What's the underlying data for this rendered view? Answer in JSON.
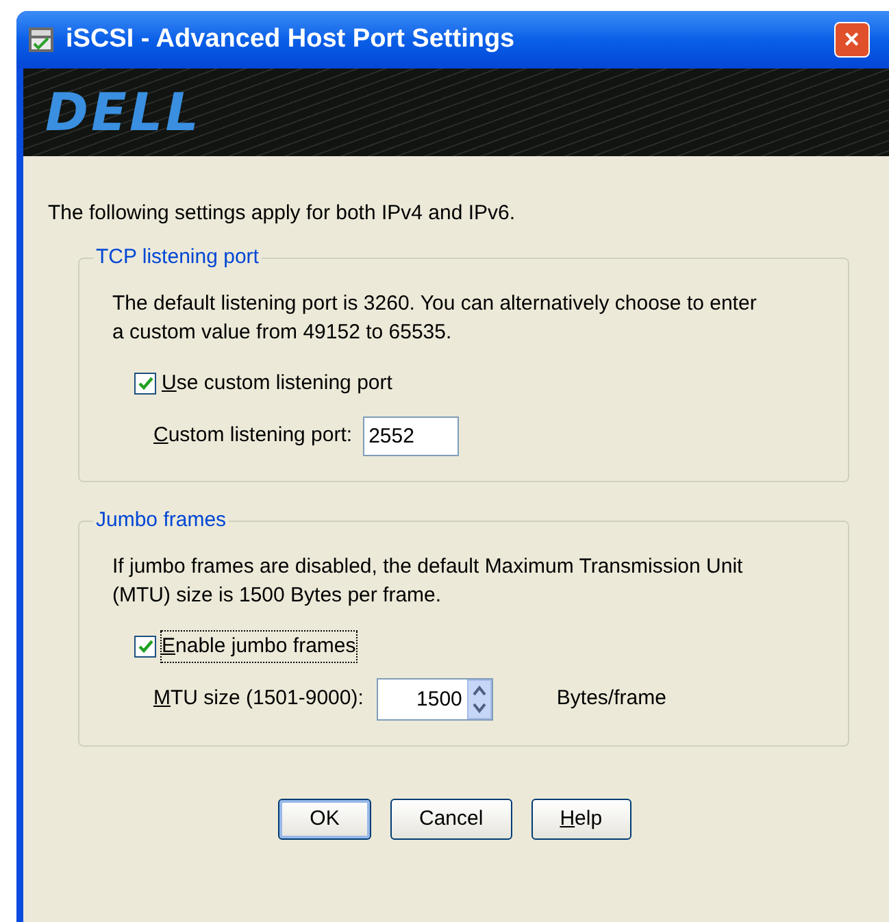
{
  "window": {
    "title": "iSCSI - Advanced Host Port Settings",
    "close": "✕"
  },
  "banner": {
    "logo": "DELL"
  },
  "intro": "The following settings apply for both IPv4 and IPv6.",
  "groups": [
    {
      "legend": "TCP listening port",
      "description": "The default listening port is 3260. You can alternatively choose to enter a custom value from 49152 to 65535.",
      "checkbox": {
        "label": "Use custom listening port",
        "checked": true,
        "focused": false,
        "mnemonic": true
      },
      "field": {
        "kind": "text",
        "label": "Custom listening port:",
        "mnemonic": true,
        "value": "2552"
      }
    },
    {
      "legend": "Jumbo frames",
      "description": "If jumbo frames are disabled, the default Maximum Transmission Unit (MTU) size is 1500 Bytes per frame.",
      "checkbox": {
        "label": "Enable jumbo frames",
        "checked": true,
        "focused": true,
        "mnemonic": true
      },
      "field": {
        "kind": "spin",
        "label": "MTU size (1501-9000):",
        "mnemonic": true,
        "value": "1500",
        "unit": "Bytes/frame"
      }
    }
  ],
  "buttons": [
    {
      "label": "OK",
      "default": true,
      "mnemonic": false
    },
    {
      "label": "Cancel",
      "default": false,
      "mnemonic": false
    },
    {
      "label": "Help",
      "default": false,
      "mnemonic": true
    }
  ]
}
